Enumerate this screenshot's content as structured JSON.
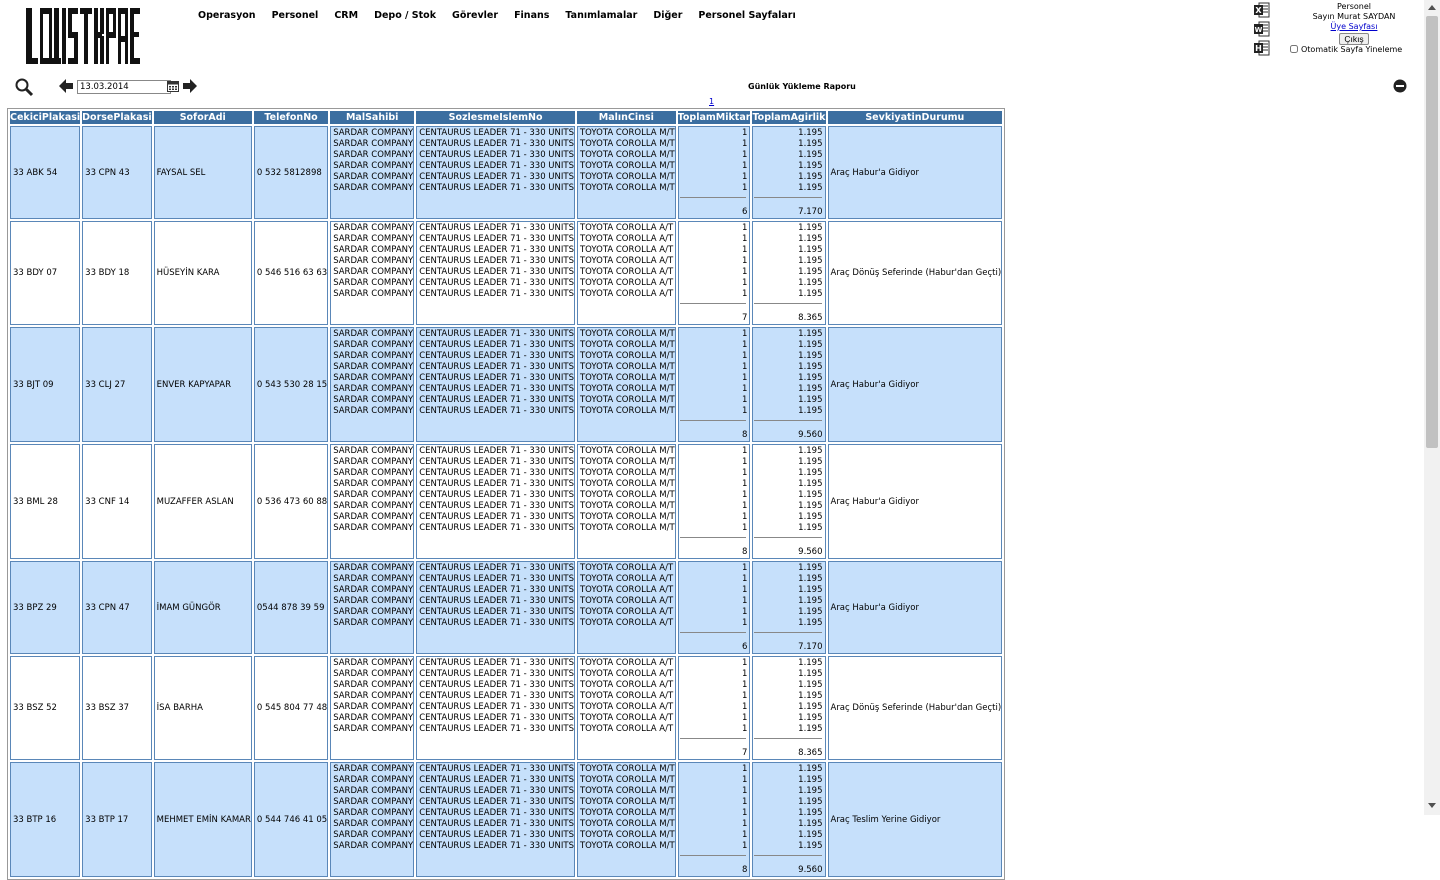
{
  "logo_text": "LOJISTIKPROGRAMI.NET",
  "nav": [
    "Operasyon",
    "Personel",
    "CRM",
    "Depo / Stok",
    "Görevler",
    "Finans",
    "Tanımlamalar",
    "Diğer",
    "Personel Sayfaları"
  ],
  "user": {
    "role": "Personel",
    "greeting": "Sayın Murat SAYDAN",
    "profile_link": "Üye Sayfası",
    "logout_label": "Çıkış",
    "auto_refresh_label": "Otomatik Sayfa Yineleme"
  },
  "toolbar": {
    "date": "13.03.2014"
  },
  "report": {
    "title": "Günlük Yükleme Raporu",
    "page": "1"
  },
  "table": {
    "columns": [
      "CekiciPlakasi",
      "DorsePlakasi",
      "SoforAdi",
      "TelefonNo",
      "MalSahibi",
      "SozlesmeIslemNo",
      "MalınCinsi",
      "ToplamMiktar",
      "ToplamAgirlik",
      "SevkiyatinDurumu"
    ],
    "rows": [
      {
        "cekici": "33 ABK 54",
        "dorse": "33 CPN 43",
        "sofor": "FAYSAL SEL",
        "telefon": "0 532 5812898",
        "owner": "SARDAR COMPANY",
        "contract": "CENTAURUS LEADER 71 - 330 UNITS",
        "cargo": "TOYOTA COROLLA M/T",
        "qty": "1",
        "weight": "1.195",
        "count": 6,
        "total_qty": "6",
        "total_weight": "7.170",
        "status": "Araç Habur'a Gidiyor"
      },
      {
        "cekici": "33 BDY 07",
        "dorse": "33 BDY 18",
        "sofor": "HÜSEYİN KARA",
        "telefon": "0 546 516 63 63",
        "owner": "SARDAR COMPANY",
        "contract": "CENTAURUS LEADER 71 - 330 UNITS",
        "cargo": "TOYOTA COROLLA A/T",
        "qty": "1",
        "weight": "1.195",
        "count": 7,
        "total_qty": "7",
        "total_weight": "8.365",
        "status": "Araç Dönüş Seferinde (Habur'dan Geçti)"
      },
      {
        "cekici": "33 BJT 09",
        "dorse": "33 CLJ 27",
        "sofor": "ENVER KAPYAPAR",
        "telefon": "0 543 530 28 15",
        "owner": "SARDAR COMPANY",
        "contract": "CENTAURUS LEADER 71 - 330 UNITS",
        "cargo": "TOYOTA COROLLA M/T",
        "qty": "1",
        "weight": "1.195",
        "count": 8,
        "total_qty": "8",
        "total_weight": "9.560",
        "status": "Araç Habur'a Gidiyor"
      },
      {
        "cekici": "33 BML 28",
        "dorse": "33 CNF 14",
        "sofor": "MUZAFFER ASLAN",
        "telefon": "0 536 473 60 88",
        "owner": "SARDAR COMPANY",
        "contract": "CENTAURUS LEADER 71 - 330 UNITS",
        "cargo": "TOYOTA COROLLA M/T",
        "qty": "1",
        "weight": "1.195",
        "count": 8,
        "total_qty": "8",
        "total_weight": "9.560",
        "status": "Araç Habur'a Gidiyor"
      },
      {
        "cekici": "33 BPZ 29",
        "dorse": "33 CPN 47",
        "sofor": "İMAM GÜNGÖR",
        "telefon": "0544 878 39 59",
        "owner": "SARDAR COMPANY",
        "contract": "CENTAURUS LEADER 71 - 330 UNITS",
        "cargo": "TOYOTA COROLLA A/T",
        "qty": "1",
        "weight": "1.195",
        "count": 6,
        "total_qty": "6",
        "total_weight": "7.170",
        "status": "Araç Habur'a Gidiyor"
      },
      {
        "cekici": "33 BSZ 52",
        "dorse": "33 BSZ 37",
        "sofor": "İSA BARHA",
        "telefon": "0 545 804 77 48",
        "owner": "SARDAR COMPANY",
        "contract": "CENTAURUS LEADER 71 - 330 UNITS",
        "cargo": "TOYOTA COROLLA A/T",
        "qty": "1",
        "weight": "1.195",
        "count": 7,
        "total_qty": "7",
        "total_weight": "8.365",
        "status": "Araç Dönüş Seferinde (Habur'dan Geçti)"
      },
      {
        "cekici": "33 BTP 16",
        "dorse": "33 BTP 17",
        "sofor": "MEHMET EMİN KAMAR",
        "telefon": "0 544 746 41 05",
        "owner": "SARDAR COMPANY",
        "contract": "CENTAURUS LEADER 71 - 330 UNITS",
        "cargo": "TOYOTA COROLLA M/T",
        "qty": "1",
        "weight": "1.195",
        "count": 8,
        "total_qty": "8",
        "total_weight": "9.560",
        "status": "Araç Teslim Yerine Gidiyor"
      }
    ]
  },
  "colors": {
    "header_bg": "#3b6ea0",
    "alt_row_bg": "#c6e0fb",
    "border": "#5a87b8"
  },
  "icons": [
    "excel-icon",
    "word-icon",
    "html-icon",
    "search-icon",
    "prev-arrow-icon",
    "calendar-icon",
    "next-arrow-icon",
    "collapse-icon"
  ]
}
